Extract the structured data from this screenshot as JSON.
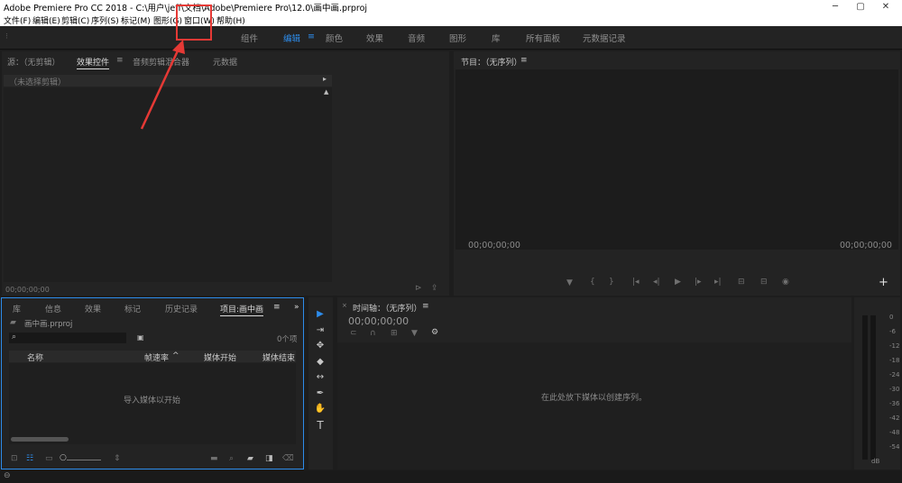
{
  "titlebar": {
    "title": "Adobe Premiere Pro CC 2018 - C:\\用户\\jeff\\文档\\Adobe\\Premiere Pro\\12.0\\画中画.prproj",
    "minimize": "─",
    "maximize": "▢",
    "close": "✕"
  },
  "menubar": {
    "items": [
      "文件(F)",
      "编辑(E)",
      "剪辑(C)",
      "序列(S)",
      "标记(M)",
      "图形(G)",
      "窗口(W)",
      "帮助(H)"
    ]
  },
  "workspace": {
    "items": [
      "组件",
      "编辑",
      "颜色",
      "效果",
      "音频",
      "图形",
      "库",
      "所有面板",
      "元数据记录"
    ],
    "active": "编辑",
    "menu_glyph": "≡"
  },
  "source_panel": {
    "tabs": [
      "源：（无剪辑）",
      "效果控件",
      "音频剪辑混合器",
      "元数据"
    ],
    "active_tab": "效果控件",
    "no_clip": "（未选择剪辑）",
    "timecode": "00;00;00;00"
  },
  "program_panel": {
    "title": "节目：（无序列）",
    "timecode_left": "00;00;00;00",
    "timecode_right": "00;00;00;00",
    "controls": [
      "▼",
      "{",
      "}",
      "|◂",
      "◂|",
      "▶",
      "|▸",
      "▸|",
      "⊟",
      "⊟",
      "◉"
    ],
    "add": "+"
  },
  "project_panel": {
    "tabs": [
      "库",
      "信息",
      "效果",
      "标记",
      "历史记录",
      "项目:画中画"
    ],
    "active_tab": "项目:画中画",
    "more": "»",
    "filename": "画中画.prproj",
    "item_count": "0个项",
    "columns": [
      "名称",
      "帧速率",
      "媒体开始",
      "媒体结束"
    ],
    "sort_glyph": "^",
    "empty": "导入媒体以开始"
  },
  "timeline_panel": {
    "title": "时间轴：（无序列）",
    "timecode": "00;00;00;00",
    "drop_hint": "在此处放下媒体以创建序列。"
  },
  "tools": [
    "▶",
    "⇥",
    "✥",
    "◆",
    "↔",
    "✒",
    "✋",
    "T"
  ],
  "audio_meter": {
    "ticks": [
      "0",
      "-6",
      "-12",
      "-18",
      "-24",
      "-30",
      "-36",
      "-42",
      "-48",
      "-54"
    ],
    "footer": "dB"
  },
  "colors": {
    "accent": "#2d8ceb",
    "highlight": "#e53935",
    "panel_bg": "#232323"
  }
}
